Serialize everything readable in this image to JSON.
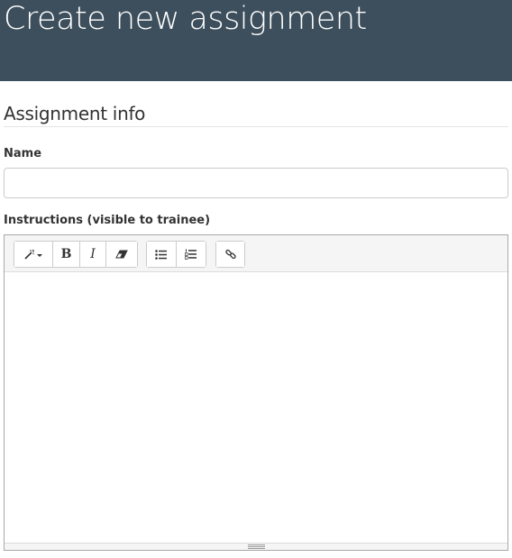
{
  "header": {
    "title": "Create new assignment"
  },
  "section": {
    "title": "Assignment info"
  },
  "name_field": {
    "label": "Name",
    "value": "",
    "placeholder": ""
  },
  "instructions_field": {
    "label": "Instructions (visible to trainee)",
    "content": ""
  },
  "toolbar": {
    "groups": [
      [
        "magic-wand-style-dropdown",
        "bold",
        "italic",
        "eraser-clear-formatting"
      ],
      [
        "unordered-list",
        "ordered-list"
      ],
      [
        "link"
      ]
    ],
    "bold_label": "B",
    "italic_label": "I"
  },
  "colors": {
    "header_bg": "#3d4f5c",
    "header_text": "#ffffff",
    "toolbar_bg": "#f5f5f5",
    "border": "#cccccc"
  }
}
